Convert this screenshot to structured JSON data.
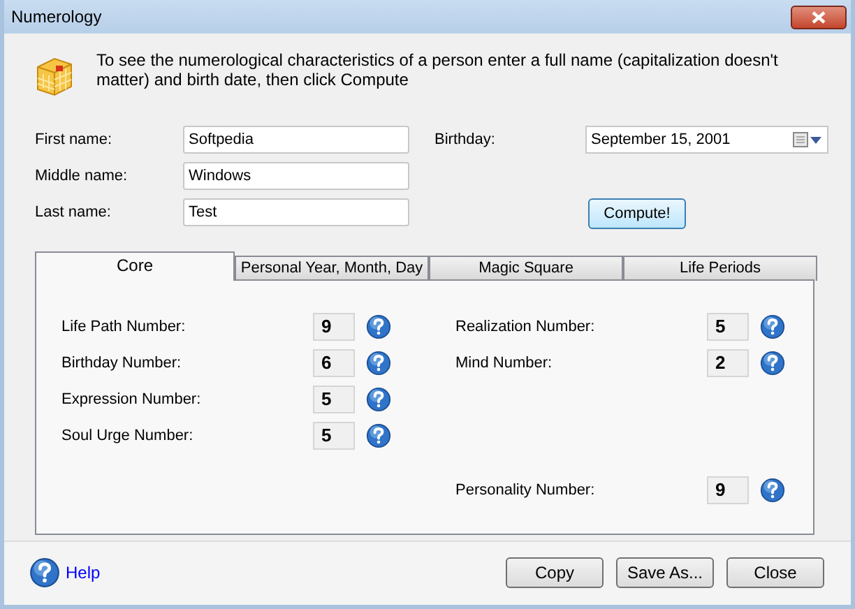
{
  "window": {
    "title": "Numerology"
  },
  "intro": "To see the numerological characteristics of a person enter a full name (capitalization doesn't matter) and birth date, then click Compute",
  "name_fields": [
    {
      "label": "First name:",
      "value": "Softpedia"
    },
    {
      "label": "Middle name:",
      "value": "Windows"
    },
    {
      "label": "Last name:",
      "value": "Test"
    }
  ],
  "birthday": {
    "label": "Birthday:",
    "value": "September 15, 2001"
  },
  "compute_button": "Compute!",
  "tabs": [
    {
      "label": "Core",
      "selected": true
    },
    {
      "label": "Personal Year, Month, Day",
      "selected": false
    },
    {
      "label": "Magic Square",
      "selected": false
    },
    {
      "label": "Life Periods",
      "selected": false
    }
  ],
  "left_numbers": [
    {
      "label": "Life Path Number:",
      "value": "9"
    },
    {
      "label": "Birthday Number:",
      "value": "6"
    },
    {
      "label": "Expression Number:",
      "value": "5"
    },
    {
      "label": "Soul Urge Number:",
      "value": "5"
    }
  ],
  "right_numbers": [
    {
      "label": "Realization Number:",
      "value": "5"
    },
    {
      "label": "Mind Number:",
      "value": "2"
    }
  ],
  "bottom_number": {
    "label": "Personality Number:",
    "value": "9"
  },
  "help_link": "Help",
  "buttons": [
    "Copy",
    "Save As...",
    "Close"
  ]
}
